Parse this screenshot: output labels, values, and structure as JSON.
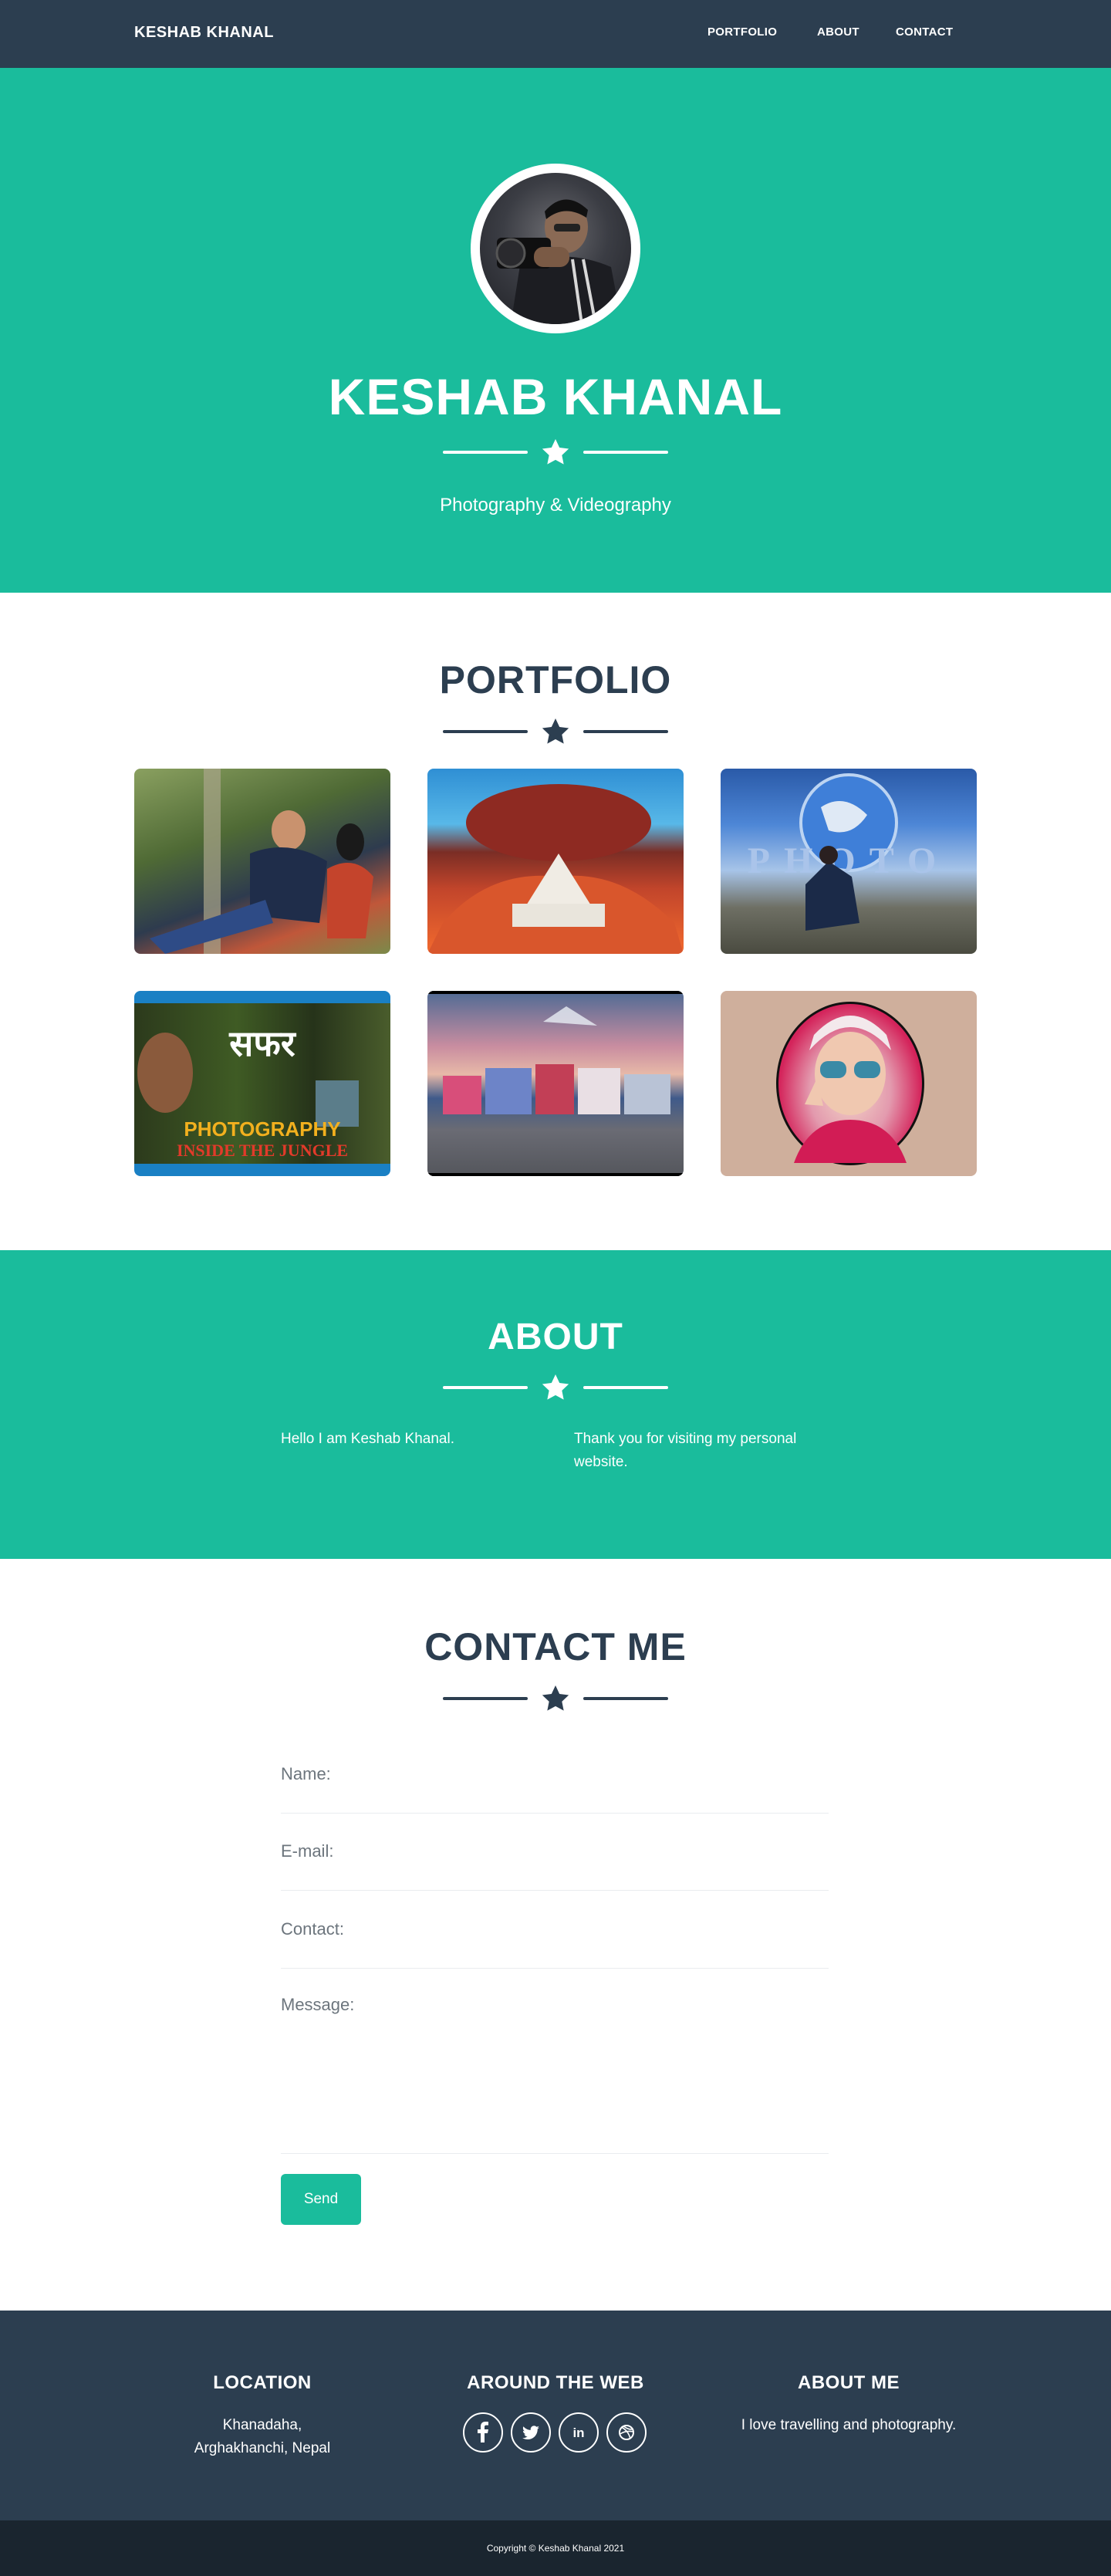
{
  "nav": {
    "brand": "KESHAB KHANAL",
    "items": [
      {
        "label": "PORTFOLIO"
      },
      {
        "label": "ABOUT"
      },
      {
        "label": "CONTACT"
      }
    ]
  },
  "masthead": {
    "title": "KESHAB KHANAL",
    "subtitle": "Photography & Videography"
  },
  "portfolio": {
    "title": "PORTFOLIO",
    "items": [
      {
        "caption": ""
      },
      {
        "caption": ""
      },
      {
        "caption": "PHOTO"
      },
      {
        "caption_top": "सफर",
        "caption_mid": "PHOTOGRAPHY",
        "caption_bottom": "INSIDE THE JUNGLE"
      },
      {
        "caption": ""
      },
      {
        "caption": ""
      }
    ]
  },
  "about": {
    "title": "ABOUT",
    "left": "Hello I am Keshab Khanal.",
    "right": "Thank you for visiting my personal website."
  },
  "contact": {
    "title": "CONTACT ME",
    "name_label": "Name:",
    "email_label": "E-mail:",
    "contact_label": "Contact:",
    "message_label": "Message:",
    "send_label": "Send"
  },
  "footer": {
    "location_title": "LOCATION",
    "location_text": "Khanadaha, Arghakhanchi, Nepal",
    "web_title": "AROUND THE WEB",
    "socials": [
      "facebook-icon",
      "twitter-icon",
      "linkedin-icon",
      "dribbble-icon"
    ],
    "me_title": "ABOUT ME",
    "me_text": "I love travelling and photography.",
    "copyright": "Copyright © Keshab Khanal 2021"
  },
  "colors": {
    "primary": "#1abc9c",
    "dark": "#2c3e50",
    "darker": "#1a252f"
  }
}
